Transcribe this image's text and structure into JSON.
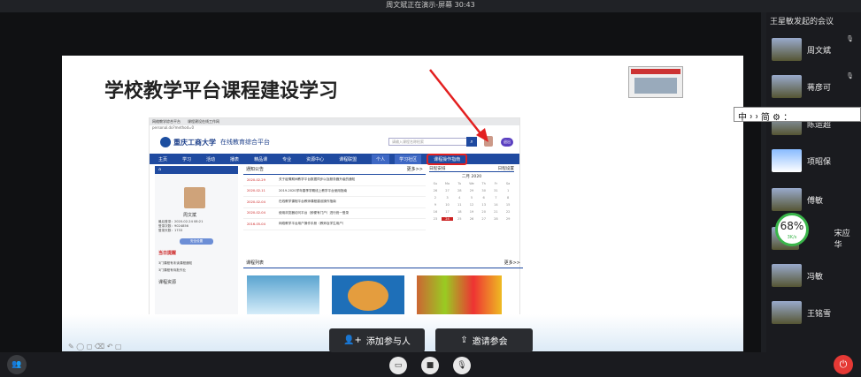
{
  "topbar": {
    "status": "周文斌正在演示-屏幕 30:43"
  },
  "slide": {
    "title": "学校教学平台课程建设学习"
  },
  "browser": {
    "tabs": [
      "网络教学综合平台",
      "课程建设在线工作网"
    ],
    "url": "personal.do?method=0"
  },
  "site": {
    "logo": "重庆工商大学",
    "logo_sub": "在线教育综合平台",
    "search_placeholder": "请输入课程名称检索",
    "user_badge": "退出",
    "nav": [
      "主页",
      "学习",
      "活动",
      "播表",
      "精品课",
      "专业",
      "资源中心",
      "课程联盟",
      "个人",
      "学习社区",
      "课程操作指南"
    ]
  },
  "profile": {
    "header": "主页",
    "name": "周文斌",
    "info": [
      "最后登录：2020-02-24 08:21",
      "登录次数：9024856",
      "登录天数：1733"
    ],
    "button": "安全设置",
    "reminder_title": "当日提醒",
    "reminders": [
      "3门课程有未读课程通知",
      "3门课程有待批作业"
    ],
    "more": "课程资源"
  },
  "notices": {
    "title": "通知公告",
    "more": "更多>>",
    "items": [
      {
        "date": "2020-02-29",
        "text": "关于疫情期间教学平台数据同步以及服务器升级的通知"
      },
      {
        "date": "2020-02-11",
        "text": "2019-2020学年春季学期线上教学平台使用指南"
      },
      {
        "date": "2020-02-04",
        "text": "在线教学课程平台教师课程建设操作指南"
      },
      {
        "date": "2020-02-04",
        "text": "使用浏览器访问平台（即便有门户）进行统一登录"
      },
      {
        "date": "2016-05-04",
        "text": "网络教学平台用户操作手册（教师及学生用户）"
      }
    ]
  },
  "courses": {
    "title": "课程列表",
    "more": "更多>>"
  },
  "calendar": {
    "title": "日程安排",
    "link": "日程设置",
    "month": "二月 2020",
    "days": [
      "Su",
      "Mo",
      "Tu",
      "We",
      "Th",
      "Fr",
      "Sa"
    ],
    "dates": [
      "26",
      "27",
      "28",
      "29",
      "30",
      "31",
      "1",
      "2",
      "3",
      "4",
      "5",
      "6",
      "7",
      "8",
      "9",
      "10",
      "11",
      "12",
      "13",
      "14",
      "15",
      "16",
      "17",
      "18",
      "19",
      "20",
      "21",
      "22",
      "23",
      "24",
      "25",
      "26",
      "27",
      "28",
      "29"
    ]
  },
  "meeting": {
    "add_label": "添加参与人",
    "invite_label": "邀请参会",
    "sidebar_title": "王星敏发起的会议",
    "participants": [
      "周文斌",
      "蒋彦可",
      "陈运超",
      "项昭保",
      "傅敏",
      "宋应华",
      "冯敏",
      "王铭雪"
    ],
    "net_percent": "68%",
    "net_speed": "3K/s",
    "ime": "中 ᠈ ᠈ 简 ⚙ ："
  }
}
